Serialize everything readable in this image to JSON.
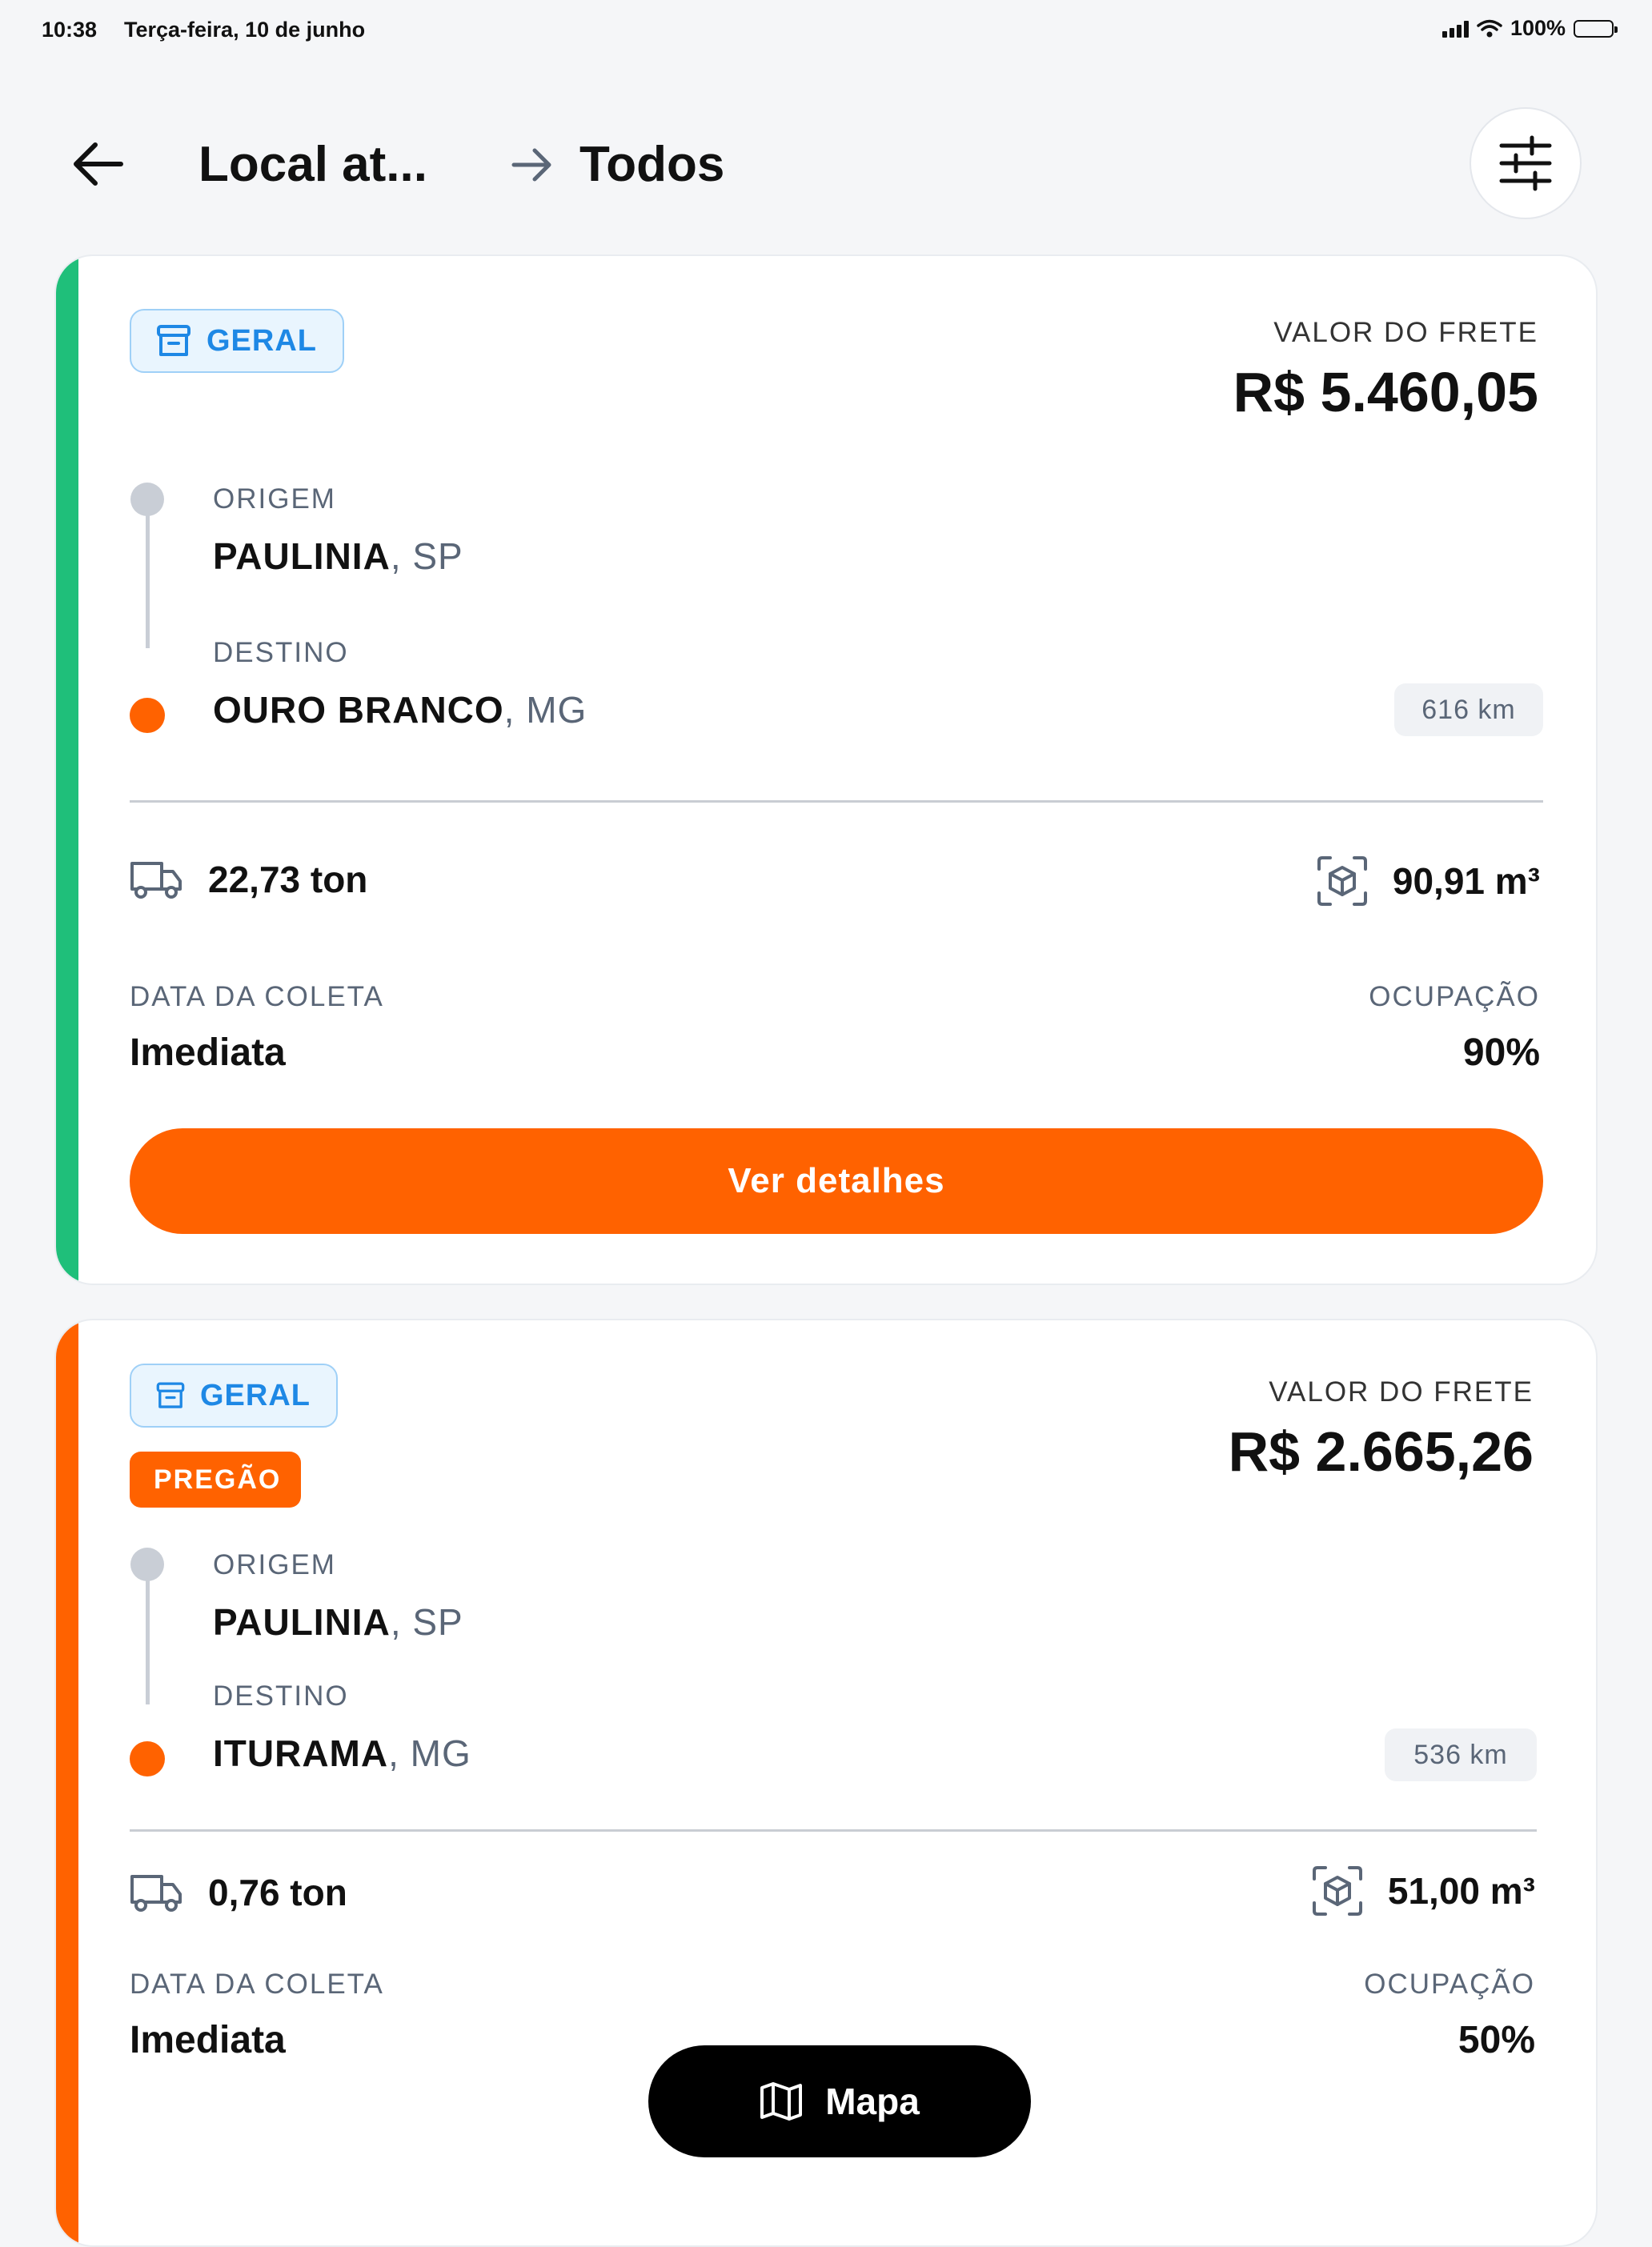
{
  "status_bar": {
    "time": "10:38",
    "date": "Terça-feira, 10 de junho",
    "battery": "100%"
  },
  "header": {
    "crumb1": "Local at...",
    "crumb2": "Todos"
  },
  "cards": [
    {
      "tag": "GERAL",
      "freight_label": "VALOR DO FRETE",
      "freight_value": "R$ 5.460,05",
      "origin_label": "ORIGEM",
      "origin_city": "PAULINIA",
      "origin_uf": ", SP",
      "dest_label": "DESTINO",
      "dest_city": "OURO BRANCO",
      "dest_uf": ", MG",
      "distance": "616 km",
      "weight": "22,73 ton",
      "volume": "90,91 m³",
      "pickup_label": "DATA DA COLETA",
      "pickup_value": "Imediata",
      "occupancy_label": "OCUPAÇÃO",
      "occupancy_value": "90%",
      "cta": "Ver detalhes",
      "stripe_color": "#1fbf7a"
    },
    {
      "tag": "GERAL",
      "badge": "PREGÃO",
      "freight_label": "VALOR DO FRETE",
      "freight_value": "R$ 2.665,26",
      "origin_label": "ORIGEM",
      "origin_city": "PAULINIA",
      "origin_uf": ", SP",
      "dest_label": "DESTINO",
      "dest_city": "ITURAMA",
      "dest_uf": ", MG",
      "distance": "536 km",
      "weight": "0,76 ton",
      "volume": "51,00 m³",
      "pickup_label": "DATA DA COLETA",
      "pickup_value": "Imediata",
      "occupancy_label": "OCUPAÇÃO",
      "occupancy_value": "50%",
      "stripe_color": "#ff6200"
    }
  ],
  "map_button": {
    "label": "Mapa"
  },
  "colors": {
    "accent": "#ff6200",
    "tag_blue": "#1e88e5"
  },
  "icons": [
    "back-arrow-icon",
    "chevron-arrow-icon",
    "filter-sliders-icon",
    "archive-box-icon",
    "truck-icon",
    "cube-scan-icon",
    "map-icon",
    "wifi-icon",
    "signal-icon",
    "battery-icon"
  ]
}
